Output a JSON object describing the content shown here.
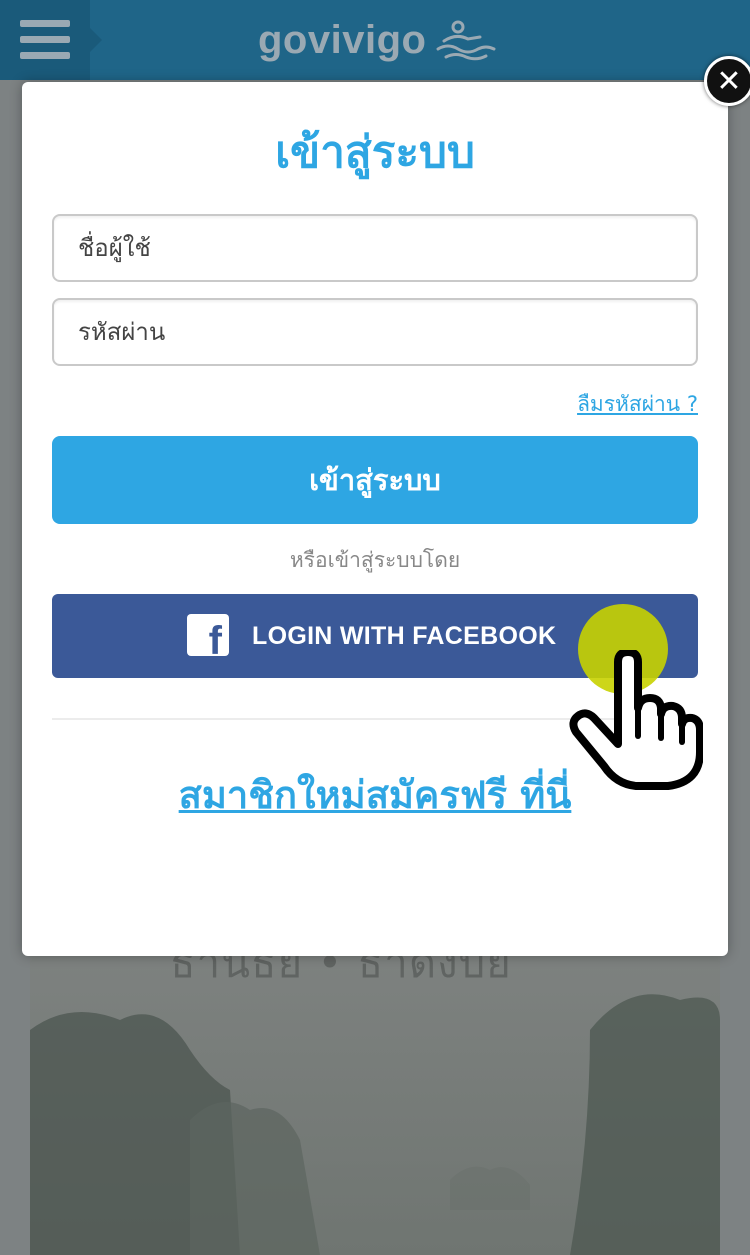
{
  "header": {
    "logo_text": "govivigo",
    "menu_icon": "hamburger-menu-icon",
    "colors": {
      "bar": "#1f6588",
      "logo": "#9aa9b3"
    }
  },
  "background": {
    "overlay_text": "ธานธย • ธาดงบย"
  },
  "login_modal": {
    "title": "เข้าสู่ระบบ",
    "username_placeholder": "ชื่อผู้ใช้",
    "password_placeholder": "รหัสผ่าน",
    "forgot_password": "ลืมรหัสผ่าน ?",
    "login_button": "เข้าสู่ระบบ",
    "or_text": "หรือเข้าสู่ระบบโดย",
    "facebook_button": "LOGIN WITH FACEBOOK",
    "signup_link": "สมาชิกใหม่สมัครฟรี ที่นี่",
    "close_icon": "close-icon",
    "colors": {
      "accent": "#2ea6e3",
      "facebook": "#3b5998"
    }
  }
}
